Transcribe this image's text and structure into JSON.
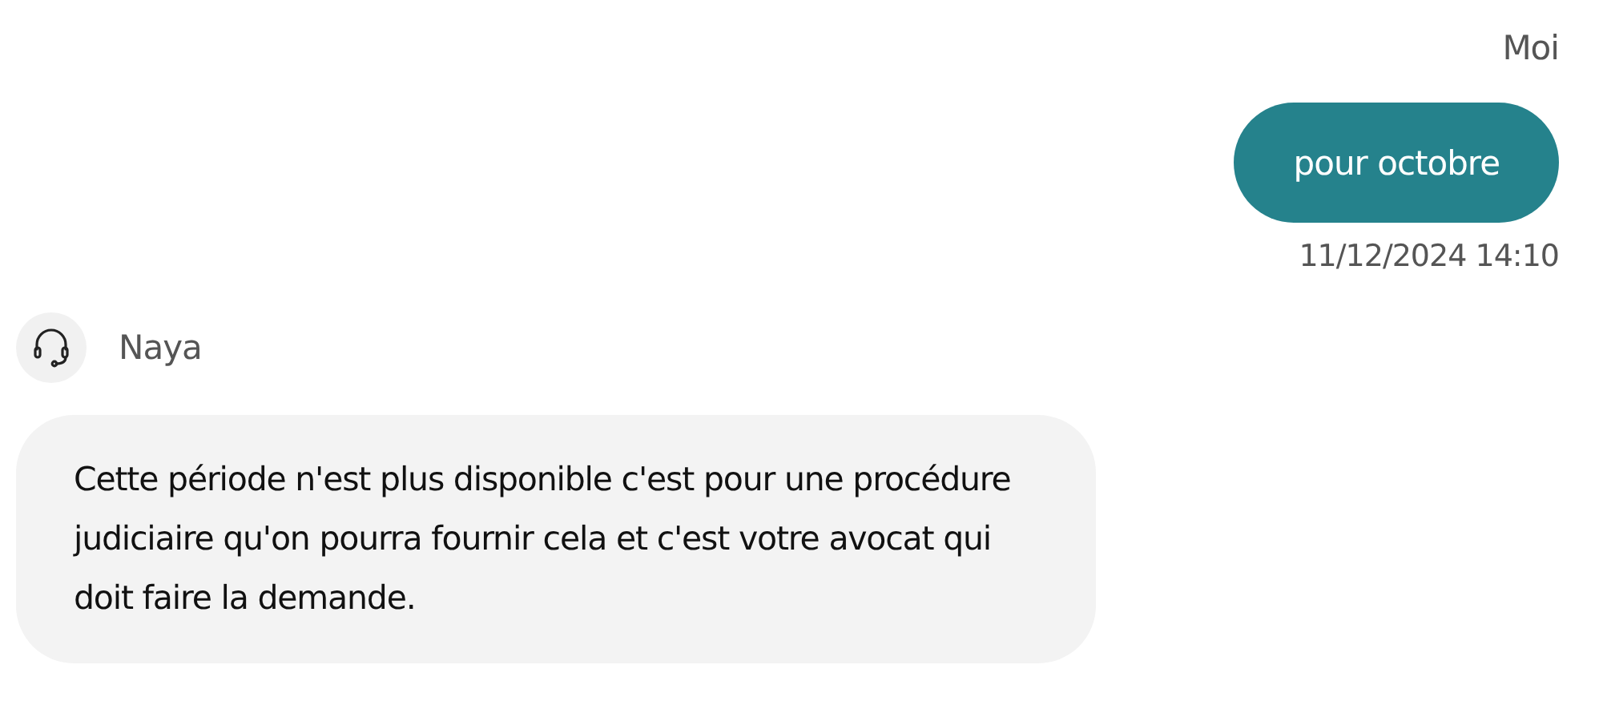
{
  "messages": [
    {
      "kind": "outgoing",
      "sender": "Moi",
      "text": "pour octobre",
      "time": "11/12/2024 14:10"
    },
    {
      "kind": "incoming",
      "sender": "Naya",
      "text": "Cette période n'est plus disponible c'est pour une procédure judiciaire qu'on pourra fournir cela et c'est votre avocat qui doit faire la demande."
    }
  ]
}
